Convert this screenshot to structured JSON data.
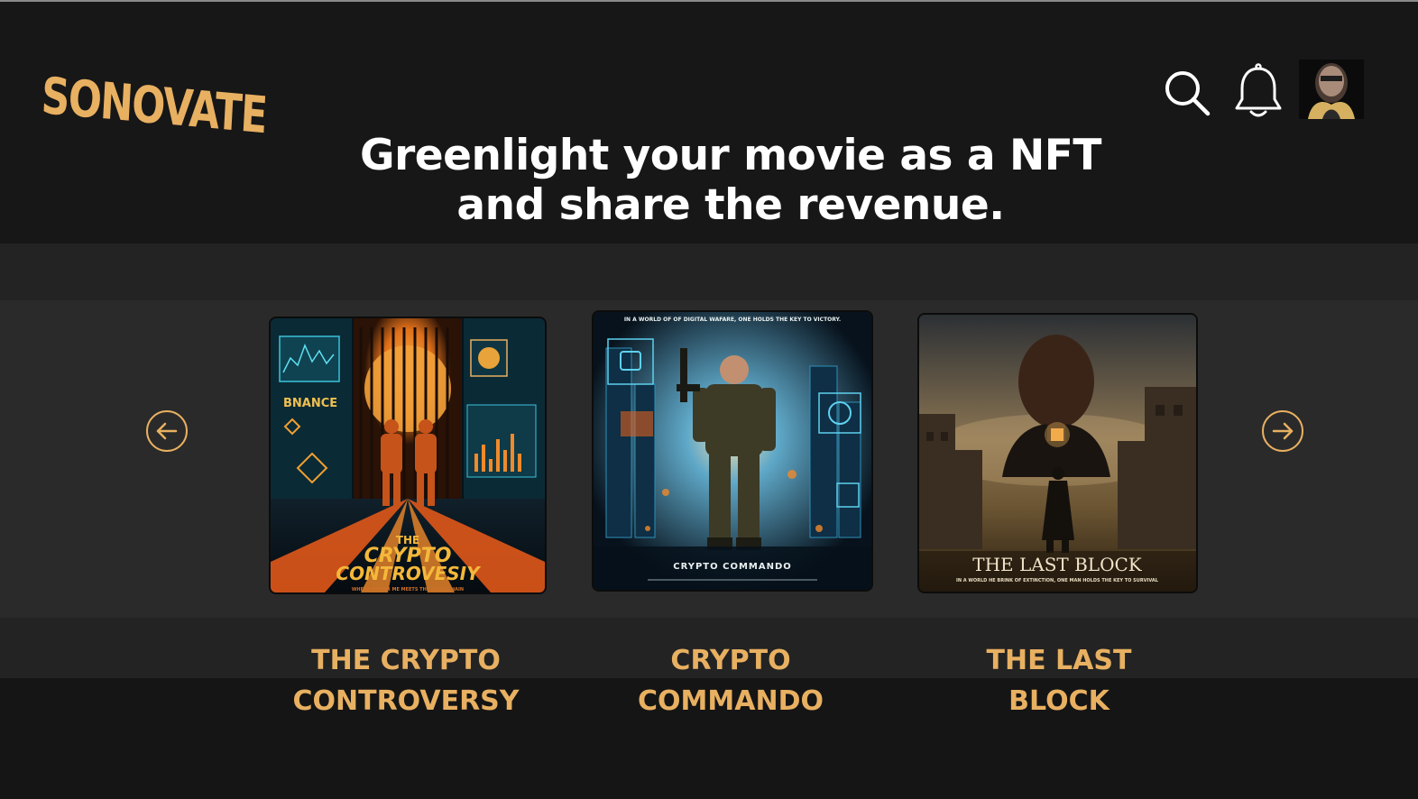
{
  "brand": {
    "logo": "SONOVATE",
    "accent": "#e8b061"
  },
  "header": {
    "headline_line1": "Greenlight your movie as a NFT",
    "headline_line2": "and share the revenue.",
    "search_icon": "search-icon",
    "bell_icon": "bell-icon",
    "avatar": "user-avatar"
  },
  "carousel": {
    "prev_icon": "arrow-left-circle-icon",
    "next_icon": "arrow-right-circle-icon",
    "items": [
      {
        "title_line1": "THE CRYPTO",
        "title_line2": "CONTROVERSY",
        "poster_title1": "THE",
        "poster_title2": "CRYPTO",
        "poster_title3": "CONTROVESIY",
        "poster_logo": "BNANCE",
        "poster_tagline": "WHERE POWER ME MEETS THE BLOCKCHAIN"
      },
      {
        "title_line1": "CRYPTO",
        "title_line2": "COMMANDO",
        "poster_tagline": "IN A WORLD OF OF DIGITAL WAFARE, ONE HOLDS THE KEY TO VICTORY.",
        "poster_title": "CRYPTO COMMANDO"
      },
      {
        "title_line1": "THE LAST",
        "title_line2": "BLOCK",
        "poster_title": "THE LAST BLOCK",
        "poster_tagline": "IN A WORLD HE BRINK OF EXTINCTION, ONE MAN HOLDS THE KEY TO SURVIVAL"
      }
    ]
  }
}
